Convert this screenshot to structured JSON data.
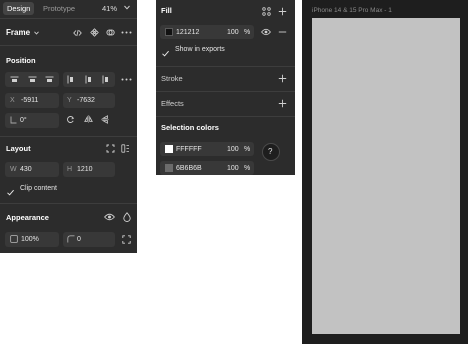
{
  "design_panel": {
    "tabs": [
      "Design",
      "Prototype"
    ],
    "zoom": "41%",
    "frame_label": "Frame",
    "position": {
      "title": "Position",
      "x_label": "X",
      "x_value": "-5911",
      "y_label": "Y",
      "y_value": "-7632",
      "rotation_value": "0°"
    },
    "layout": {
      "title": "Layout",
      "w_label": "W",
      "w_value": "430",
      "h_label": "H",
      "h_value": "1210",
      "clip_content": "Clip content"
    },
    "appearance": {
      "title": "Appearance",
      "opacity": "100%",
      "radius": "0"
    }
  },
  "fill_panel": {
    "fill": {
      "title": "Fill",
      "hex": "121212",
      "opacity": "100",
      "percent": "%",
      "show_in_exports": "Show in exports",
      "swatch_color": "#121212"
    },
    "stroke_title": "Stroke",
    "effects_title": "Effects",
    "selection_colors": {
      "title": "Selection colors",
      "items": [
        {
          "hex": "FFFFFF",
          "opacity": "100",
          "percent": "%",
          "color": "#ffffff"
        },
        {
          "hex": "6B6B6B",
          "opacity": "100",
          "percent": "%",
          "color": "#6b6b6b"
        }
      ]
    },
    "help": "?"
  },
  "canvas": {
    "frame_name": "iPhone 14 & 15 Pro Max - 1",
    "frame_fill": "#c2c2c2"
  }
}
